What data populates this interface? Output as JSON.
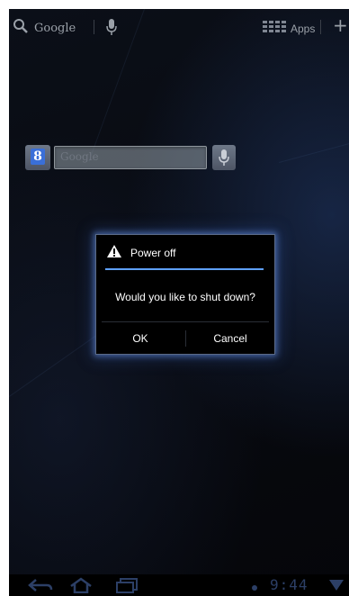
{
  "topbar": {
    "search_label": "Google",
    "search_icon": "search-icon",
    "mic_icon": "mic-icon",
    "apps_label": "Apps",
    "apps_icon": "apps-grid-icon",
    "add_icon": "plus-icon",
    "add_glyph": "+"
  },
  "widget": {
    "logo_letter": "8",
    "placeholder": "Google",
    "mic_icon": "mic-icon"
  },
  "dialog": {
    "title": "Power off",
    "title_icon": "warning-icon",
    "message": "Would you like to shut down?",
    "ok_label": "OK",
    "cancel_label": "Cancel",
    "accent": "#5ea0ff"
  },
  "systembar": {
    "back_icon": "back-icon",
    "home_icon": "home-icon",
    "recent_icon": "recent-apps-icon",
    "clock": "9:44"
  },
  "colors": {
    "background": "#080a10",
    "dialog_glow": "#6a8cdc",
    "text_dim": "#9aa0a8"
  }
}
